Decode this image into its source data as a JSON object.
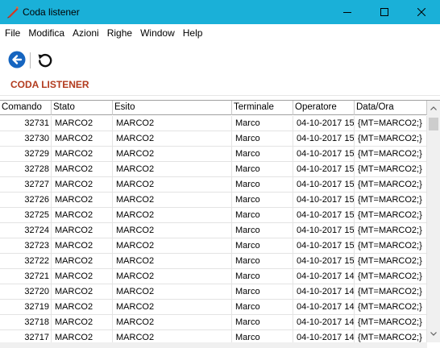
{
  "window": {
    "title": "Coda listener"
  },
  "menu": [
    "File",
    "Modifica",
    "Azioni",
    "Righe",
    "Window",
    "Help"
  ],
  "toolbar": {
    "back_icon": "back-arrow-circle-icon",
    "refresh_icon": "refresh-icon"
  },
  "section_title": "CODA LISTENER",
  "table": {
    "headers": [
      "Comando",
      "Stato",
      "Esito",
      "Terminale",
      "Operatore",
      "Data/Ora"
    ],
    "rows": [
      [
        "32731",
        "MARCO2",
        "MARCO2",
        "Marco",
        "04-10-2017 15",
        "{MT=MARCO2;}"
      ],
      [
        "32730",
        "MARCO2",
        "MARCO2",
        "Marco",
        "04-10-2017 15",
        "{MT=MARCO2;}"
      ],
      [
        "32729",
        "MARCO2",
        "MARCO2",
        "Marco",
        "04-10-2017 15",
        "{MT=MARCO2;}"
      ],
      [
        "32728",
        "MARCO2",
        "MARCO2",
        "Marco",
        "04-10-2017 15",
        "{MT=MARCO2;}"
      ],
      [
        "32727",
        "MARCO2",
        "MARCO2",
        "Marco",
        "04-10-2017 15",
        "{MT=MARCO2;}"
      ],
      [
        "32726",
        "MARCO2",
        "MARCO2",
        "Marco",
        "04-10-2017 15",
        "{MT=MARCO2;}"
      ],
      [
        "32725",
        "MARCO2",
        "MARCO2",
        "Marco",
        "04-10-2017 15",
        "{MT=MARCO2;}"
      ],
      [
        "32724",
        "MARCO2",
        "MARCO2",
        "Marco",
        "04-10-2017 15",
        "{MT=MARCO2;}"
      ],
      [
        "32723",
        "MARCO2",
        "MARCO2",
        "Marco",
        "04-10-2017 15",
        "{MT=MARCO2;}"
      ],
      [
        "32722",
        "MARCO2",
        "MARCO2",
        "Marco",
        "04-10-2017 15",
        "{MT=MARCO2;}"
      ],
      [
        "32721",
        "MARCO2",
        "MARCO2",
        "Marco",
        "04-10-2017 14",
        "{MT=MARCO2;}"
      ],
      [
        "32720",
        "MARCO2",
        "MARCO2",
        "Marco",
        "04-10-2017 14",
        "{MT=MARCO2;}"
      ],
      [
        "32719",
        "MARCO2",
        "MARCO2",
        "Marco",
        "04-10-2017 14",
        "{MT=MARCO2;}"
      ],
      [
        "32718",
        "MARCO2",
        "MARCO2",
        "Marco",
        "04-10-2017 14",
        "{MT=MARCO2;}"
      ],
      [
        "32717",
        "MARCO2",
        "MARCO2",
        "Marco",
        "04-10-2017 14",
        "{MT=MARCO2;}"
      ]
    ]
  },
  "colors": {
    "titlebar": "#1ab0d8",
    "section_title": "#b23b1e",
    "back_button": "#1565c0"
  }
}
